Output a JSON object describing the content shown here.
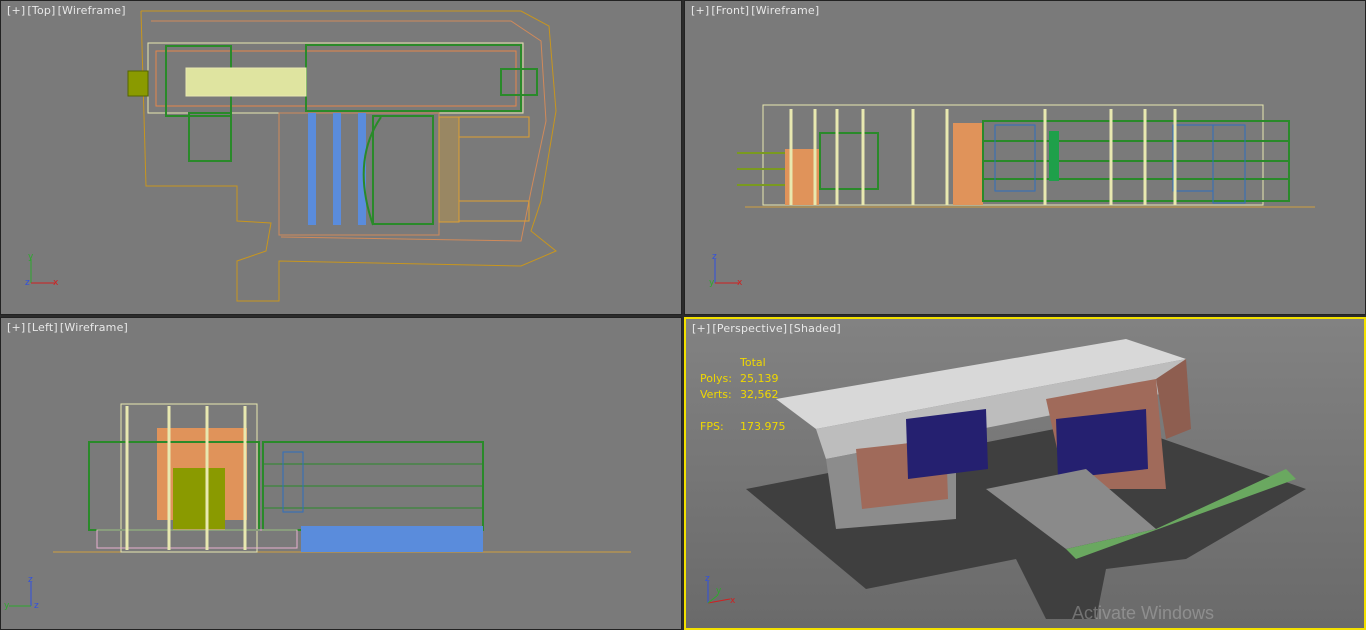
{
  "viewports": {
    "top": {
      "plus": "[+]",
      "view": "[Top]",
      "mode": "[Wireframe]",
      "axes": [
        "y",
        "z",
        "x"
      ]
    },
    "front": {
      "plus": "[+]",
      "view": "[Front]",
      "mode": "[Wireframe]",
      "axes": [
        "z",
        "y",
        "x"
      ]
    },
    "left": {
      "plus": "[+]",
      "view": "[Left]",
      "mode": "[Wireframe]",
      "axes": [
        "z",
        "y",
        "z"
      ]
    },
    "perspective": {
      "plus": "[+]",
      "view": "[Perspective]",
      "mode": "[Shaded]",
      "axes": [
        "z",
        "y",
        "x"
      ]
    }
  },
  "stats": {
    "total_label": "Total",
    "polys_label": "Polys:",
    "polys": "25,139",
    "verts_label": "Verts:",
    "verts": "32,562",
    "fps_label": "FPS:",
    "fps": "173.975"
  },
  "watermark": "Activate Windows",
  "colors": {
    "active_border": "#f2e000",
    "viewport_bg": "#7a7a7a",
    "stats": "#f0d800"
  }
}
